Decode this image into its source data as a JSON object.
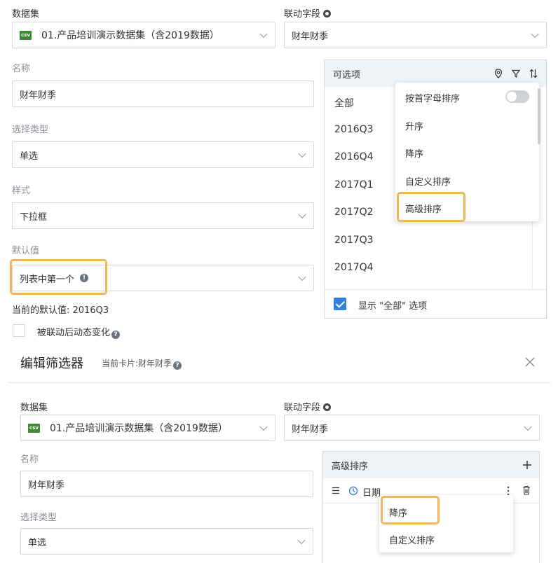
{
  "top": {
    "dataset_label": "数据集",
    "dataset_value": "01.产品培训演示数据集（含2019数据）",
    "csv_badge": "csv",
    "linked_field_label": "联动字段",
    "linked_field_value": "财年财季",
    "name_label": "名称",
    "name_value": "财年财季",
    "select_type_label": "选择类型",
    "select_type_value": "单选",
    "style_label": "样式",
    "style_value": "下拉框",
    "default_label": "默认值",
    "default_value": "列表中第一个",
    "current_default": "当前的默认值: 2016Q3",
    "linked_change_label": "被联动后动态变化",
    "options_panel": {
      "title": "可选项",
      "items": [
        "全部",
        "2016Q3",
        "2016Q4",
        "2017Q1",
        "2017Q2",
        "2017Q3",
        "2017Q4"
      ],
      "show_all_label": "显示 \"全部\" 选项"
    },
    "sort_menu": {
      "items": [
        "按首字母排序",
        "升序",
        "降序",
        "自定义排序",
        "高级排序"
      ]
    }
  },
  "editor": {
    "title": "编辑筛选器",
    "current_card": "当前卡片:财年财季",
    "dataset_label": "数据集",
    "dataset_value": "01.产品培训演示数据集（含2019数据）",
    "linked_field_label": "联动字段",
    "linked_field_value": "财年财季",
    "name_label": "名称",
    "name_value": "财年财季",
    "select_type_label": "选择类型",
    "select_type_value": "单选",
    "adv_sort": {
      "title": "高级排序",
      "row_label": "日期",
      "menu_items": [
        "降序",
        "自定义排序"
      ]
    }
  },
  "colors": {
    "highlight": "#f0b75a",
    "accent": "#2f7ee0",
    "panel_header": "#eef3f8"
  }
}
